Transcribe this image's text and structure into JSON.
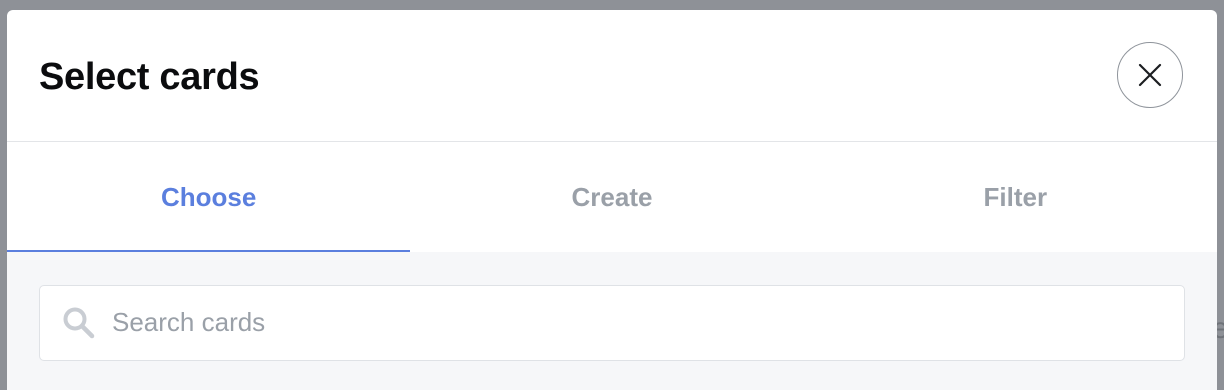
{
  "dialog": {
    "title": "Select cards",
    "close_icon": "close-icon"
  },
  "tabs": [
    {
      "label": "Choose",
      "active": true
    },
    {
      "label": "Create",
      "active": false
    },
    {
      "label": "Filter",
      "active": false
    }
  ],
  "search": {
    "placeholder": "Search cards",
    "value": "",
    "icon": "search-icon"
  },
  "colors": {
    "accent": "#5b7fde",
    "inactive_tab": "#9aa0a8",
    "backdrop": "#8e9197"
  }
}
